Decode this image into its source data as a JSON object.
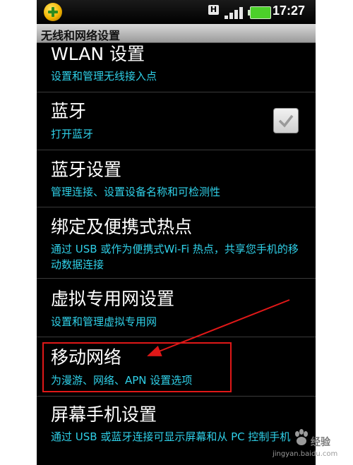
{
  "status_bar": {
    "network_badge": "H",
    "time": "17:27",
    "signal_bars": 4,
    "battery_color": "#4cd02a"
  },
  "title_bar": {
    "title": "无线和网络设置"
  },
  "items": [
    {
      "title": "WLAN 设置",
      "subtitle": "设置和管理无线接入点"
    },
    {
      "title": "蓝牙",
      "subtitle": "打开蓝牙",
      "checked": true
    },
    {
      "title": "蓝牙设置",
      "subtitle": "管理连接、设置设备名称和可检测性"
    },
    {
      "title": "绑定及便携式热点",
      "subtitle": "通过 USB 或作为便携式Wi-Fi 热点，共享您手机的移动数据连接"
    },
    {
      "title": "虚拟专用网设置",
      "subtitle": "设置和管理虚拟专用网"
    },
    {
      "title": "移动网络",
      "subtitle": "为漫游、网络、APN 设置选项"
    },
    {
      "title": "屏幕手机设置",
      "subtitle": "通过 USB 或蓝牙连接可显示屏幕和从 PC 控制手机"
    }
  ],
  "watermark": {
    "label": "经验",
    "url_text": "jingyan.baidu.com"
  },
  "colors": {
    "subtitle": "#2fd0e8",
    "annotation": "#e01818"
  },
  "icons": {
    "app": "plus-app-icon",
    "signal": "signal-icon",
    "battery": "battery-icon"
  }
}
